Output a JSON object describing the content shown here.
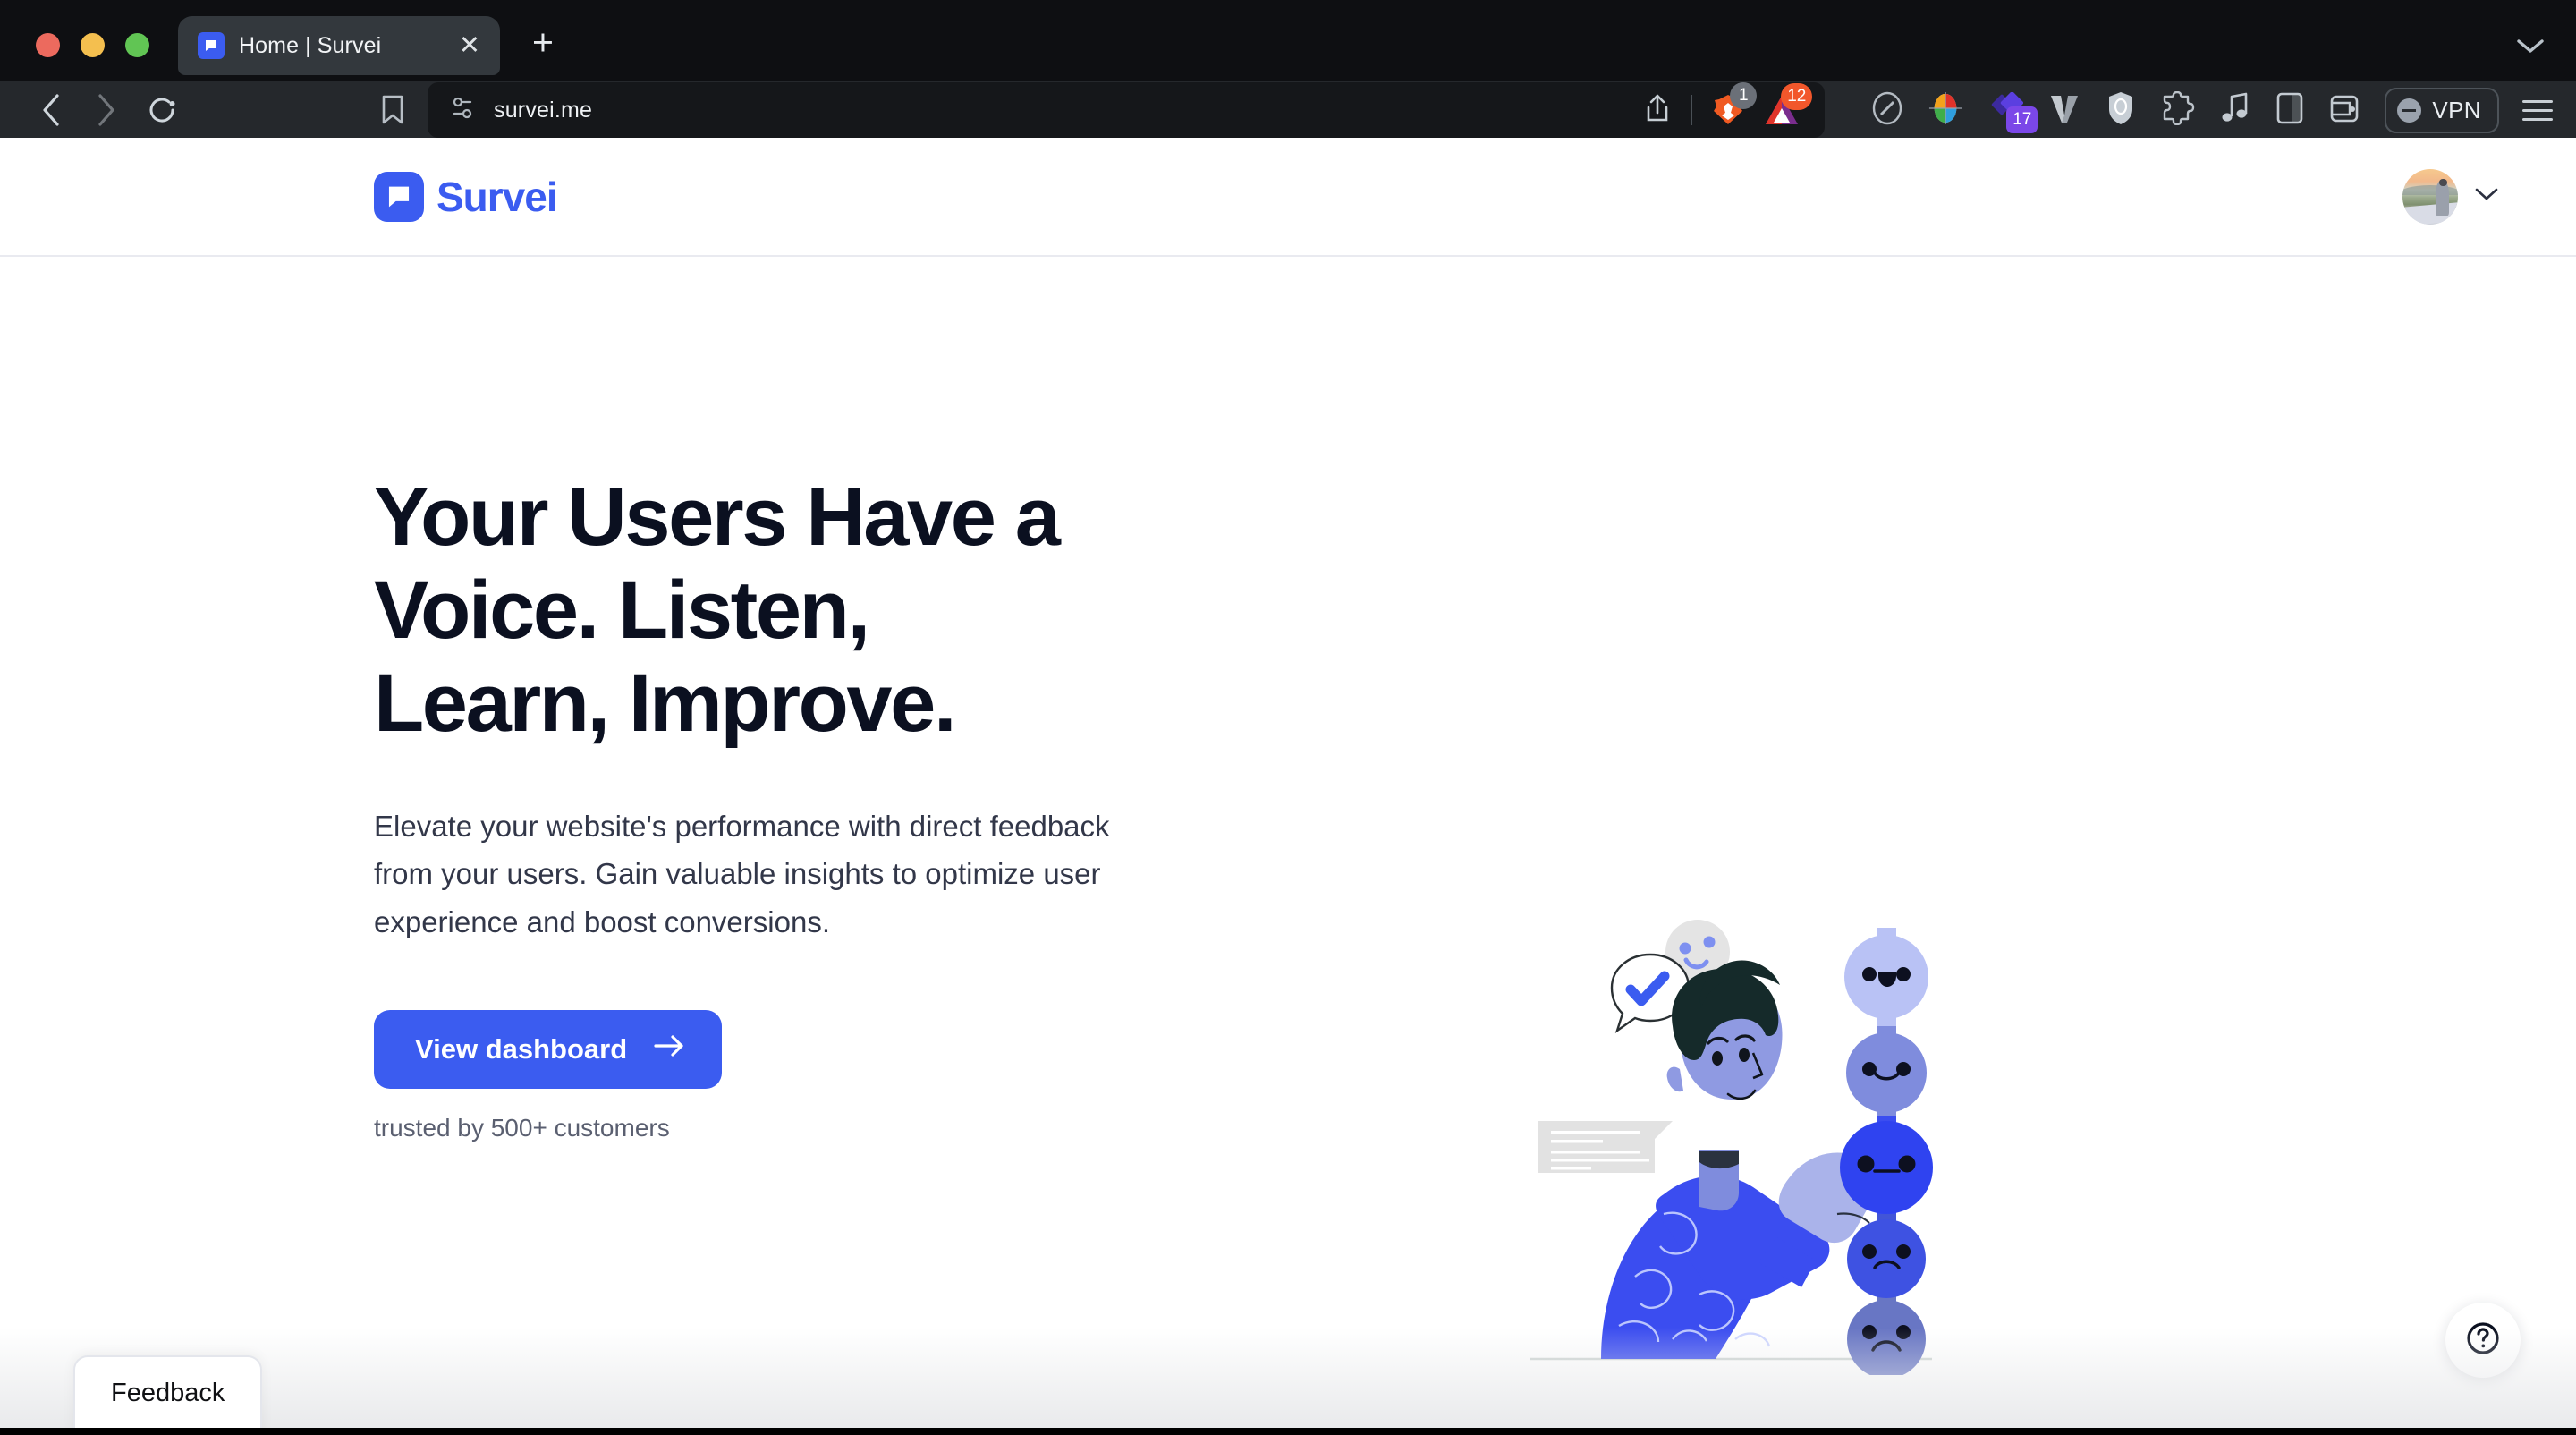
{
  "browser": {
    "name": "Brave",
    "tab": {
      "title": "Home | Survei",
      "favicon_icon": "speech-bubble-icon",
      "close_icon": "close-icon"
    },
    "new_tab_icon": "plus-icon",
    "tab_search_icon": "chevron-down-icon",
    "nav": {
      "back_icon": "chevron-left-icon",
      "forward_icon": "chevron-right-icon",
      "reload_icon": "reload-icon",
      "bookmark_icon": "bookmark-icon"
    },
    "address_bar": {
      "permissions_icon": "sliders-icon",
      "url": "survei.me",
      "share_icon": "share-icon",
      "shields": {
        "icon": "brave-lion-icon",
        "badge": "1"
      },
      "rewards": {
        "icon": "bat-triangle-icon",
        "badge": "12"
      }
    },
    "extensions": [
      {
        "name": "pen-oval-icon",
        "badge": ""
      },
      {
        "name": "color-wheel-icon",
        "badge": ""
      },
      {
        "name": "purple-diamond-icon",
        "badge": "17"
      },
      {
        "name": "v-logo-icon",
        "badge": ""
      },
      {
        "name": "shield-icon",
        "badge": ""
      },
      {
        "name": "puzzle-piece-icon",
        "badge": ""
      },
      {
        "name": "music-note-icon",
        "badge": ""
      },
      {
        "name": "sidebar-panel-icon",
        "badge": ""
      },
      {
        "name": "wallet-icon",
        "badge": ""
      }
    ],
    "vpn": {
      "label": "VPN",
      "icon": "minus-circle-icon",
      "state": "off"
    },
    "menu_icon": "hamburger-menu-icon"
  },
  "site": {
    "header": {
      "logo_text": "Survei",
      "logo_icon": "speech-bubble-icon",
      "account": {
        "avatar_icon": "user-avatar",
        "chevron_icon": "chevron-down-icon"
      }
    },
    "hero": {
      "title": "Your Users Have a\nVoice. Listen,\nLearn, Improve.",
      "subtitle": "Elevate your website's performance with direct feedback\nfrom your users. Gain valuable insights to optimize user\nexperience and boost conversions.",
      "cta_label": "View dashboard",
      "cta_icon": "arrow-right-icon",
      "trusted_text": "trusted by 500+ customers",
      "illustration": {
        "name": "user-feedback-illustration",
        "elements": [
          "speech-bubble-with-check",
          "gray-smiley-face",
          "gray-message-card",
          "person-pointing",
          "satisfaction-scale"
        ],
        "scale_faces": [
          "very-happy",
          "happy",
          "neutral",
          "slightly-sad",
          "sad"
        ]
      }
    },
    "feedback_tab_label": "Feedback",
    "help_button_icon": "question-mark-circle-icon"
  },
  "colors": {
    "brand_blue": "#3b5cf0",
    "heading_navy": "#0b1020",
    "body_gray": "#323749",
    "chrome_dark": "#25282c",
    "tabstrip_dark": "#0e0f12",
    "stripe_orange": "#d45f38"
  }
}
